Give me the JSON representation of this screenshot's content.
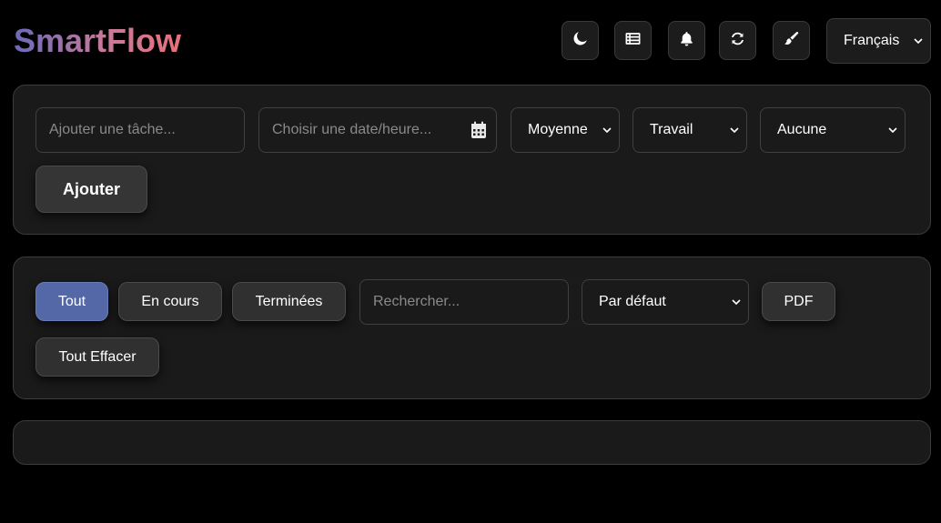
{
  "app": {
    "title": "SmartFlow"
  },
  "header": {
    "icons": [
      {
        "name": "moon-icon"
      },
      {
        "name": "list-icon"
      },
      {
        "name": "bell-icon"
      },
      {
        "name": "refresh-icon"
      },
      {
        "name": "paintbrush-icon"
      }
    ],
    "language": {
      "selected": "Français"
    }
  },
  "add_task": {
    "task_placeholder": "Ajouter une tâche...",
    "task_value": "",
    "date_placeholder": "Choisir une date/heure...",
    "date_value": "",
    "priority_selected": "Moyenne",
    "category_selected": "Travail",
    "recurrence_selected": "Aucune",
    "add_label": "Ajouter"
  },
  "filters": {
    "all_label": "Tout",
    "in_progress_label": "En cours",
    "done_label": "Terminées",
    "search_placeholder": "Rechercher...",
    "search_value": "",
    "sort_selected": "Par défaut",
    "pdf_label": "PDF",
    "clear_all_label": "Tout Effacer",
    "active_filter": "Tout"
  },
  "colors": {
    "background": "#000000",
    "panel": "#1a1a1a",
    "active_filter": "#5468a8",
    "logo_gradient_start": "#6a6ab8",
    "logo_gradient_end": "#e8707a"
  }
}
